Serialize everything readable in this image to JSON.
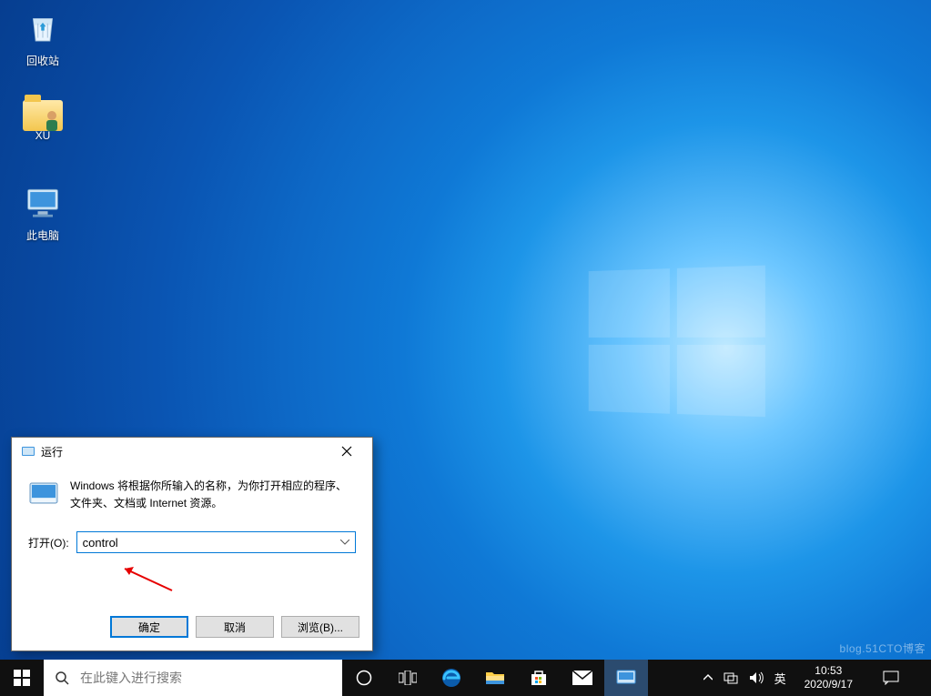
{
  "desktop": {
    "icons": [
      {
        "name": "recycle-bin",
        "label": "回收站"
      },
      {
        "name": "folder-xu",
        "label": "XU"
      },
      {
        "name": "this-pc",
        "label": "此电脑"
      }
    ]
  },
  "run_dialog": {
    "title": "运行",
    "description": "Windows 将根据你所输入的名称，为你打开相应的程序、文件夹、文档或 Internet 资源。",
    "open_label": "打开(O):",
    "open_value": "control",
    "buttons": {
      "ok": "确定",
      "cancel": "取消",
      "browse": "浏览(B)..."
    }
  },
  "taskbar": {
    "search_placeholder": "在此键入进行搜索",
    "items": [
      {
        "name": "cortana-icon"
      },
      {
        "name": "task-view-icon"
      },
      {
        "name": "edge-icon"
      },
      {
        "name": "file-explorer-icon"
      },
      {
        "name": "microsoft-store-icon"
      },
      {
        "name": "mail-icon"
      },
      {
        "name": "run-app-icon",
        "active": true
      }
    ],
    "tray": {
      "ime": "英",
      "time": "10:53",
      "date": "2020/9/17"
    }
  },
  "watermark": "blog.51CTO博客"
}
